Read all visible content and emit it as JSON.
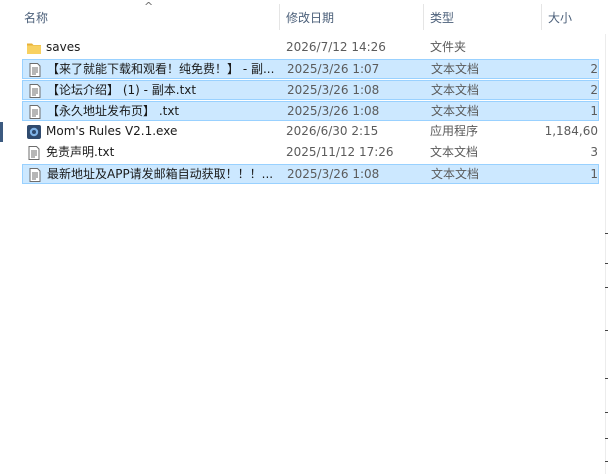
{
  "columns": {
    "name": "名称",
    "modified": "修改日期",
    "type": "类型",
    "size": "大小"
  },
  "sort_indicator": "^",
  "files": [
    {
      "name": "saves",
      "modified": "2026/7/12 14:26",
      "type": "文件夹",
      "size": "",
      "icon": "folder-icon",
      "selected": false
    },
    {
      "name": "【来了就能下载和观看！纯免费！】 - 副...",
      "modified": "2025/3/26 1:07",
      "type": "文本文档",
      "size": "2",
      "icon": "text-file-icon",
      "selected": true
    },
    {
      "name": "【论坛介绍】 (1) - 副本.txt",
      "modified": "2025/3/26 1:08",
      "type": "文本文档",
      "size": "2",
      "icon": "text-file-icon",
      "selected": true
    },
    {
      "name": "【永久地址发布页】 .txt",
      "modified": "2025/3/26 1:08",
      "type": "文本文档",
      "size": "1",
      "icon": "text-file-icon",
      "selected": true
    },
    {
      "name": "Mom's Rules V2.1.exe",
      "modified": "2026/6/30 2:15",
      "type": "应用程序",
      "size": "1,184,60",
      "icon": "app-exe-icon",
      "selected": false
    },
    {
      "name": "免责声明.txt",
      "modified": "2025/11/12 17:26",
      "type": "文本文档",
      "size": "3",
      "icon": "text-file-icon",
      "selected": false
    },
    {
      "name": "最新地址及APP请发邮箱自动获取！！！...",
      "modified": "2025/3/26 1:08",
      "type": "文本文档",
      "size": "1",
      "icon": "text-file-icon",
      "selected": true
    }
  ],
  "colors": {
    "selection_bg": "#cce8ff",
    "selection_border": "#99d1ff",
    "folder": "#f4c54a",
    "header_text": "#4c607a"
  }
}
